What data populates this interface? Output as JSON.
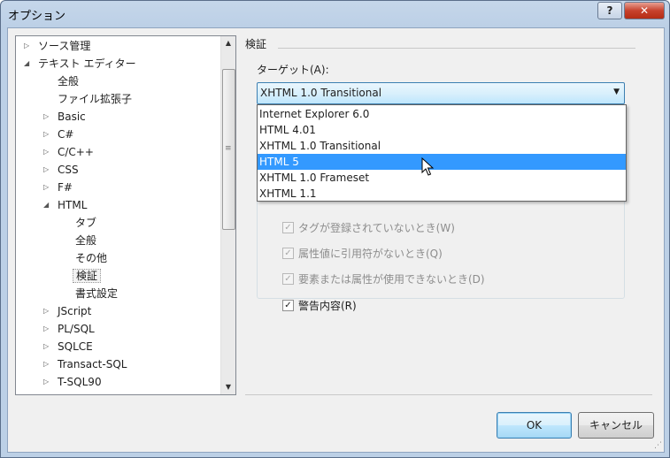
{
  "window": {
    "title": "オプション",
    "help_glyph": "?",
    "close_glyph": "✕"
  },
  "tree": {
    "items": [
      {
        "label": "ソース管理",
        "arrow": "▷",
        "selected": false
      },
      {
        "label": "テキスト エディター",
        "arrow": "◢",
        "selected": false
      },
      {
        "label": "全般",
        "arrow": "",
        "selected": false
      },
      {
        "label": "ファイル拡張子",
        "arrow": "",
        "selected": false
      },
      {
        "label": "Basic",
        "arrow": "▷",
        "selected": false
      },
      {
        "label": "C#",
        "arrow": "▷",
        "selected": false
      },
      {
        "label": "C/C++",
        "arrow": "▷",
        "selected": false
      },
      {
        "label": "CSS",
        "arrow": "▷",
        "selected": false
      },
      {
        "label": "F#",
        "arrow": "▷",
        "selected": false
      },
      {
        "label": "HTML",
        "arrow": "◢",
        "selected": false
      },
      {
        "label": "タブ",
        "arrow": "",
        "selected": false
      },
      {
        "label": "全般",
        "arrow": "",
        "selected": false
      },
      {
        "label": "その他",
        "arrow": "",
        "selected": false
      },
      {
        "label": "検証",
        "arrow": "",
        "selected": true
      },
      {
        "label": "書式設定",
        "arrow": "",
        "selected": false
      },
      {
        "label": "JScript",
        "arrow": "▷",
        "selected": false
      },
      {
        "label": "PL/SQL",
        "arrow": "▷",
        "selected": false
      },
      {
        "label": "SQLCE",
        "arrow": "▷",
        "selected": false
      },
      {
        "label": "Transact-SQL",
        "arrow": "▷",
        "selected": false
      },
      {
        "label": "T-SQL90",
        "arrow": "▷",
        "selected": false
      }
    ],
    "scroll_up_glyph": "▲",
    "scroll_down_glyph": "▼",
    "grip_glyph": "≡"
  },
  "panel": {
    "section_title": "検証",
    "target_label": "ターゲット(A):",
    "target_value": "XHTML 1.0 Transitional",
    "caret_glyph": "▼",
    "dropdown_options": [
      {
        "label": "Internet Explorer 6.0",
        "highlighted": false
      },
      {
        "label": "HTML 4.01",
        "highlighted": false
      },
      {
        "label": "XHTML 1.0 Transitional",
        "highlighted": false
      },
      {
        "label": "HTML 5",
        "highlighted": true
      },
      {
        "label": "XHTML 1.0 Frameset",
        "highlighted": false
      },
      {
        "label": "XHTML 1.1",
        "highlighted": false
      }
    ],
    "checkboxes": [
      {
        "label": "タグが登録されていないとき(W)",
        "checked": true,
        "enabled": false
      },
      {
        "label": "属性値に引用符がないとき(Q)",
        "checked": true,
        "enabled": false
      },
      {
        "label": "要素または属性が使用できないとき(D)",
        "checked": true,
        "enabled": false
      },
      {
        "label": "警告内容(R)",
        "checked": true,
        "enabled": true
      }
    ],
    "check_glyph": "✓"
  },
  "buttons": {
    "ok": "OK",
    "cancel": "キャンセル"
  },
  "colors": {
    "highlight": "#3399ff",
    "title_bar": "#c5d6ea",
    "close": "#c7422d"
  }
}
